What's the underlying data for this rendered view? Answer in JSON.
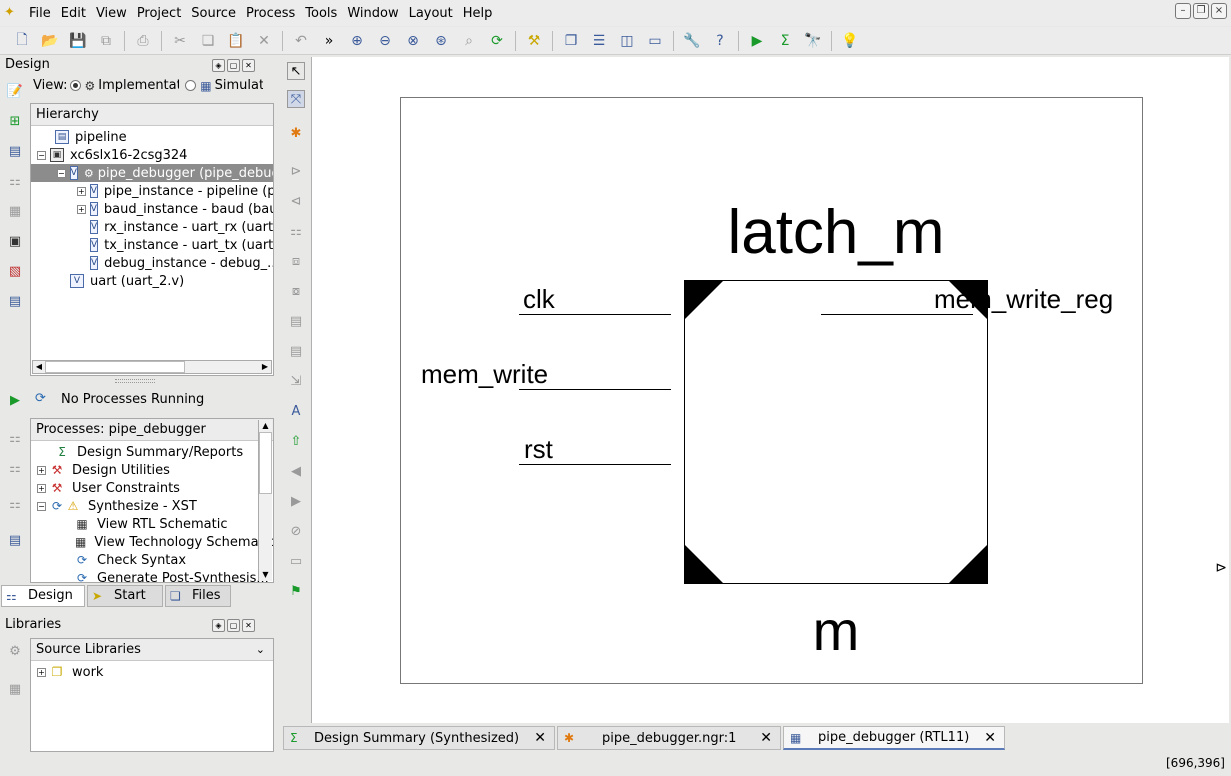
{
  "menubar": {
    "items": [
      "File",
      "Edit",
      "View",
      "Project",
      "Source",
      "Process",
      "Tools",
      "Window",
      "Layout",
      "Help"
    ]
  },
  "toolbar": {
    "icons": [
      "new-file-icon",
      "open-folder-icon",
      "save-icon",
      "save-all-icon",
      "print-icon",
      "cut-icon",
      "copy-icon",
      "paste-icon",
      "delete-icon",
      "undo-icon",
      "more-icon",
      "zoom-in-icon",
      "zoom-out-icon",
      "zoom-fit-icon",
      "zoom-area-icon",
      "zoom-select-icon",
      "refresh-icon",
      "hammer-icon",
      "cascade-icon",
      "tile-horizontal-icon",
      "tile-vertical-icon",
      "window-icon",
      "wrench-icon",
      "help-query-icon",
      "run-icon",
      "sigma-icon",
      "telescope-icon",
      "lightbulb-icon"
    ]
  },
  "design_panel": {
    "title": "Design",
    "view_label": "View:",
    "implementation_label": "Implementation",
    "simulation_label": "Simulation",
    "hierarchy_header": "Hierarchy",
    "tree": [
      {
        "label": "pipeline"
      },
      {
        "label": "xc6slx16-2csg324"
      },
      {
        "label": "pipe_debugger (pipe_debugger.v)"
      },
      {
        "label": "pipe_instance - pipeline (pipeline.v)"
      },
      {
        "label": "baud_instance - baud (baud.v)"
      },
      {
        "label": "rx_instance - uart_rx (uart_rx.v)"
      },
      {
        "label": "tx_instance - uart_tx (uart_tx.v)"
      },
      {
        "label": "debug_instance - debug_..."
      },
      {
        "label": "uart (uart_2.v)"
      }
    ]
  },
  "process_panel": {
    "status": "No Processes Running",
    "header": "Processes: pipe_debugger",
    "items": [
      {
        "label": "Design Summary/Reports"
      },
      {
        "label": "Design Utilities"
      },
      {
        "label": "User Constraints"
      },
      {
        "label": "Synthesize - XST"
      },
      {
        "label": "View RTL Schematic"
      },
      {
        "label": "View Technology Schematic"
      },
      {
        "label": "Check Syntax"
      },
      {
        "label": "Generate Post-Synthesis..."
      }
    ]
  },
  "left_tabs": {
    "design": "Design",
    "start": "Start",
    "files": "Files"
  },
  "libraries_panel": {
    "title": "Libraries",
    "dropdown": "Source Libraries",
    "items": [
      {
        "label": "work"
      }
    ]
  },
  "schematic": {
    "instance_type": "latch_m",
    "instance_name": "m",
    "inputs": [
      "clk",
      "mem_write",
      "rst"
    ],
    "outputs": [
      "mem_write_reg"
    ]
  },
  "editor_tabs": [
    {
      "label": "Design Summary (Synthesized)"
    },
    {
      "label": "pipe_debugger.ngr:1"
    },
    {
      "label": "pipe_debugger (RTL11)"
    }
  ],
  "status": {
    "coords": "[696,396]"
  },
  "colors": {
    "selection": "#8c8c8c",
    "accent": "#3a5a9a"
  }
}
